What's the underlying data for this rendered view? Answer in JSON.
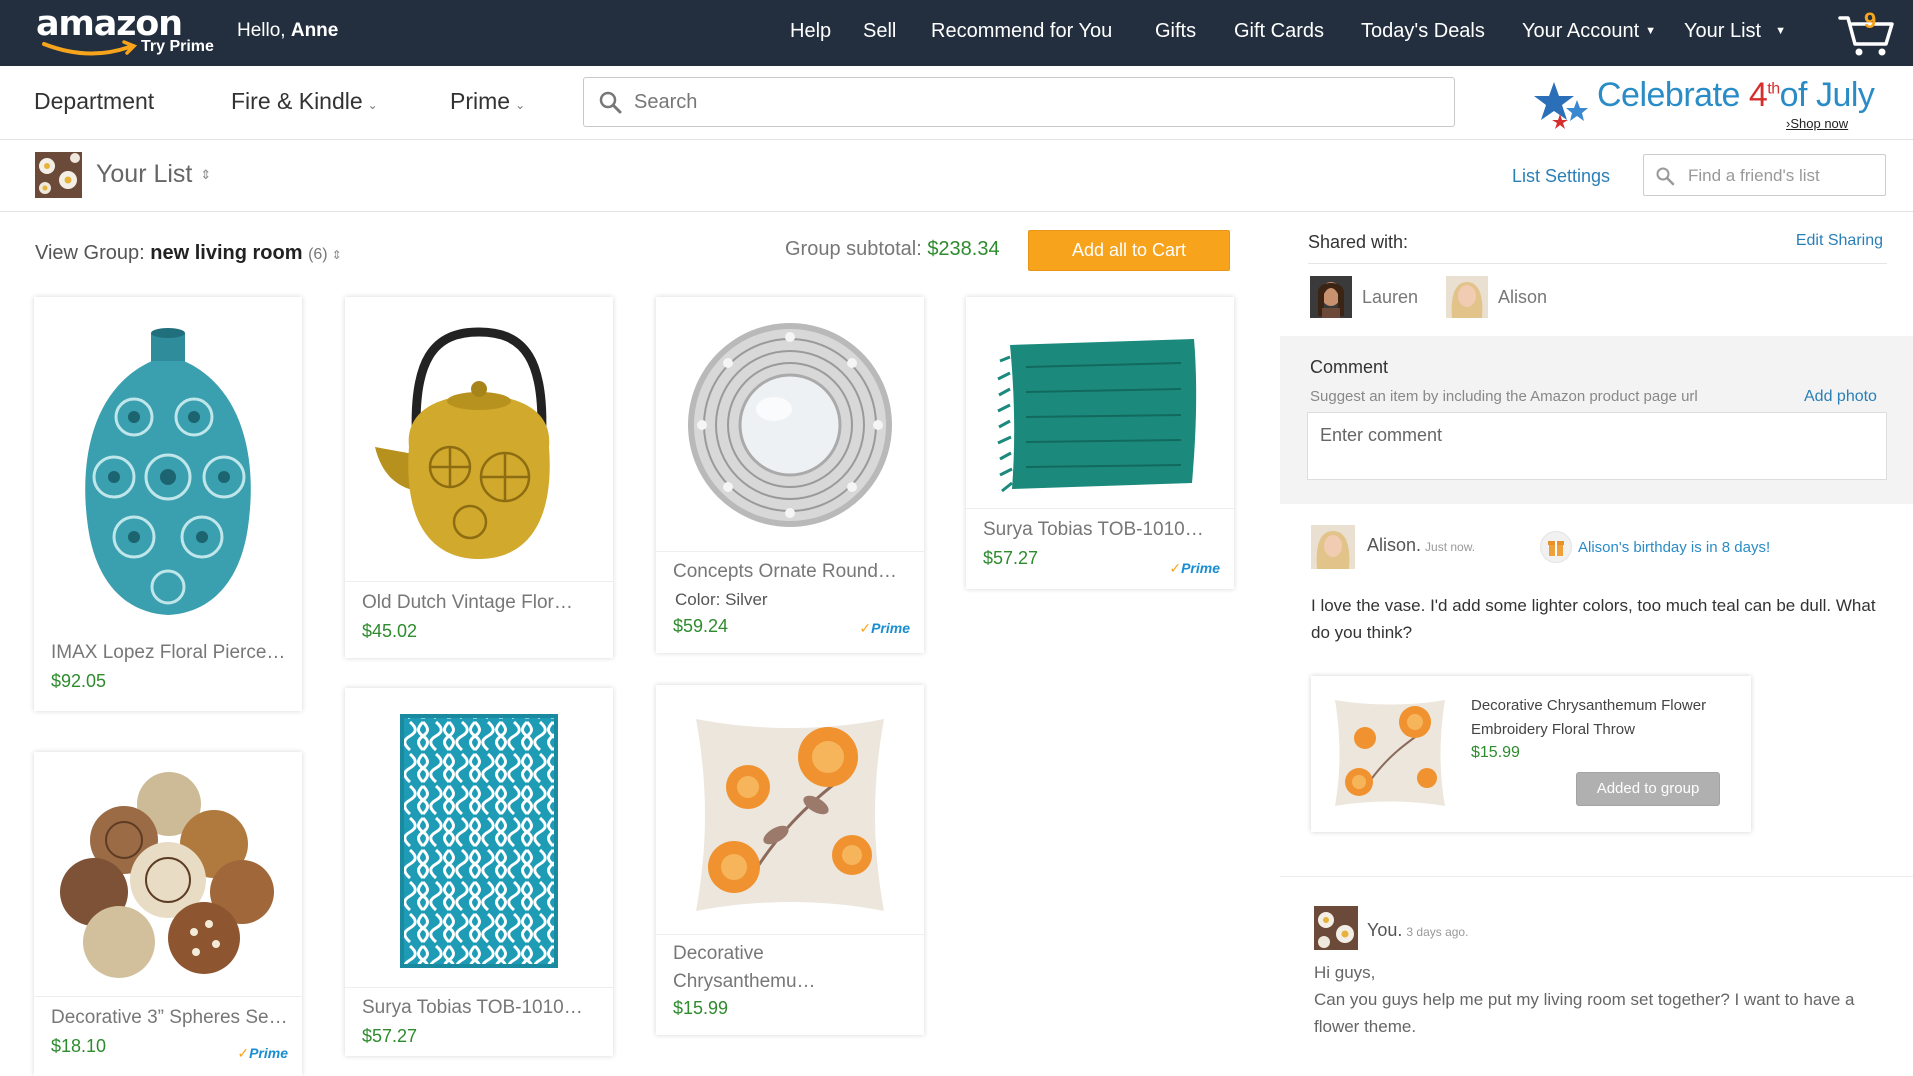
{
  "header": {
    "logo_text": "amazon",
    "logo_sub": "Try Prime",
    "greeting_prefix": "Hello,",
    "user_name": "Anne",
    "nav": [
      "Help",
      "Sell",
      "Recommend for You",
      "Gifts",
      "Gift Cards",
      "Today's Deals",
      "Your Account",
      "Your List"
    ],
    "cart_count": "9"
  },
  "subnav": {
    "items": [
      "Department",
      "Fire & Kindle",
      "Prime"
    ],
    "search_placeholder": "Search"
  },
  "promo": {
    "text_a": "Celebrate ",
    "text_b": "4",
    "text_sup": "th",
    "text_c": "of July",
    "link": "Shop now"
  },
  "list": {
    "title": "Your List",
    "settings": "List Settings",
    "friend_search_placeholder": "Find a friend's list"
  },
  "group": {
    "label": "View Group:",
    "name": "new living room",
    "count": "(6)",
    "subtotal_label": "Group subtotal:",
    "subtotal": "$238.34",
    "add_all": "Add all to Cart"
  },
  "products": [
    {
      "title": "IMAX Lopez Floral Pierce…",
      "price": "$92.05"
    },
    {
      "title": "Old Dutch Vintage Flor…",
      "price": "$45.02"
    },
    {
      "title": "Concepts Ornate Round…",
      "variant": "Color: Silver",
      "price": "$59.24",
      "prime": "Prime"
    },
    {
      "title": "Surya Tobias TOB-1010…",
      "price": "$57.27",
      "prime": "Prime"
    },
    {
      "title": "Decorative 3” Spheres Set…",
      "price": "$18.10",
      "prime": "Prime"
    },
    {
      "title": "Surya Tobias TOB-1010…",
      "price": "$57.27"
    },
    {
      "title": "Decorative Chrysanthemu…",
      "price": "$15.99"
    }
  ],
  "panel": {
    "shared_label": "Shared with:",
    "edit_sharing": "Edit  Sharing",
    "people": [
      "Lauren",
      "Alison"
    ],
    "comment_label": "Comment",
    "comment_hint": "Suggest an item by including the Amazon product page url",
    "add_photo": "Add photo",
    "comment_placeholder": "Enter comment"
  },
  "thread": {
    "msg1": {
      "name": "Alison.",
      "time": "Just now.",
      "birthday": "Alison's birthday is in 8 days!",
      "text": "I love the vase. I'd add some lighter colors, too much teal can be dull. What do you think?"
    },
    "rec": {
      "title": "Decorative Chrysanthemum Flower Embroidery Floral Throw",
      "price": "$15.99",
      "button": "Added to group"
    },
    "msg2": {
      "name": "You.",
      "time": "3 days ago.",
      "text_a": "Hi guys,",
      "text_b": "Can you guys help me put my living room set together? I want to have a flower theme."
    }
  },
  "colors": {
    "topbar": "#232f3e",
    "accent_orange": "#f7a31c",
    "link_blue": "#2a7fb8",
    "price_green": "#2e8b2e"
  }
}
